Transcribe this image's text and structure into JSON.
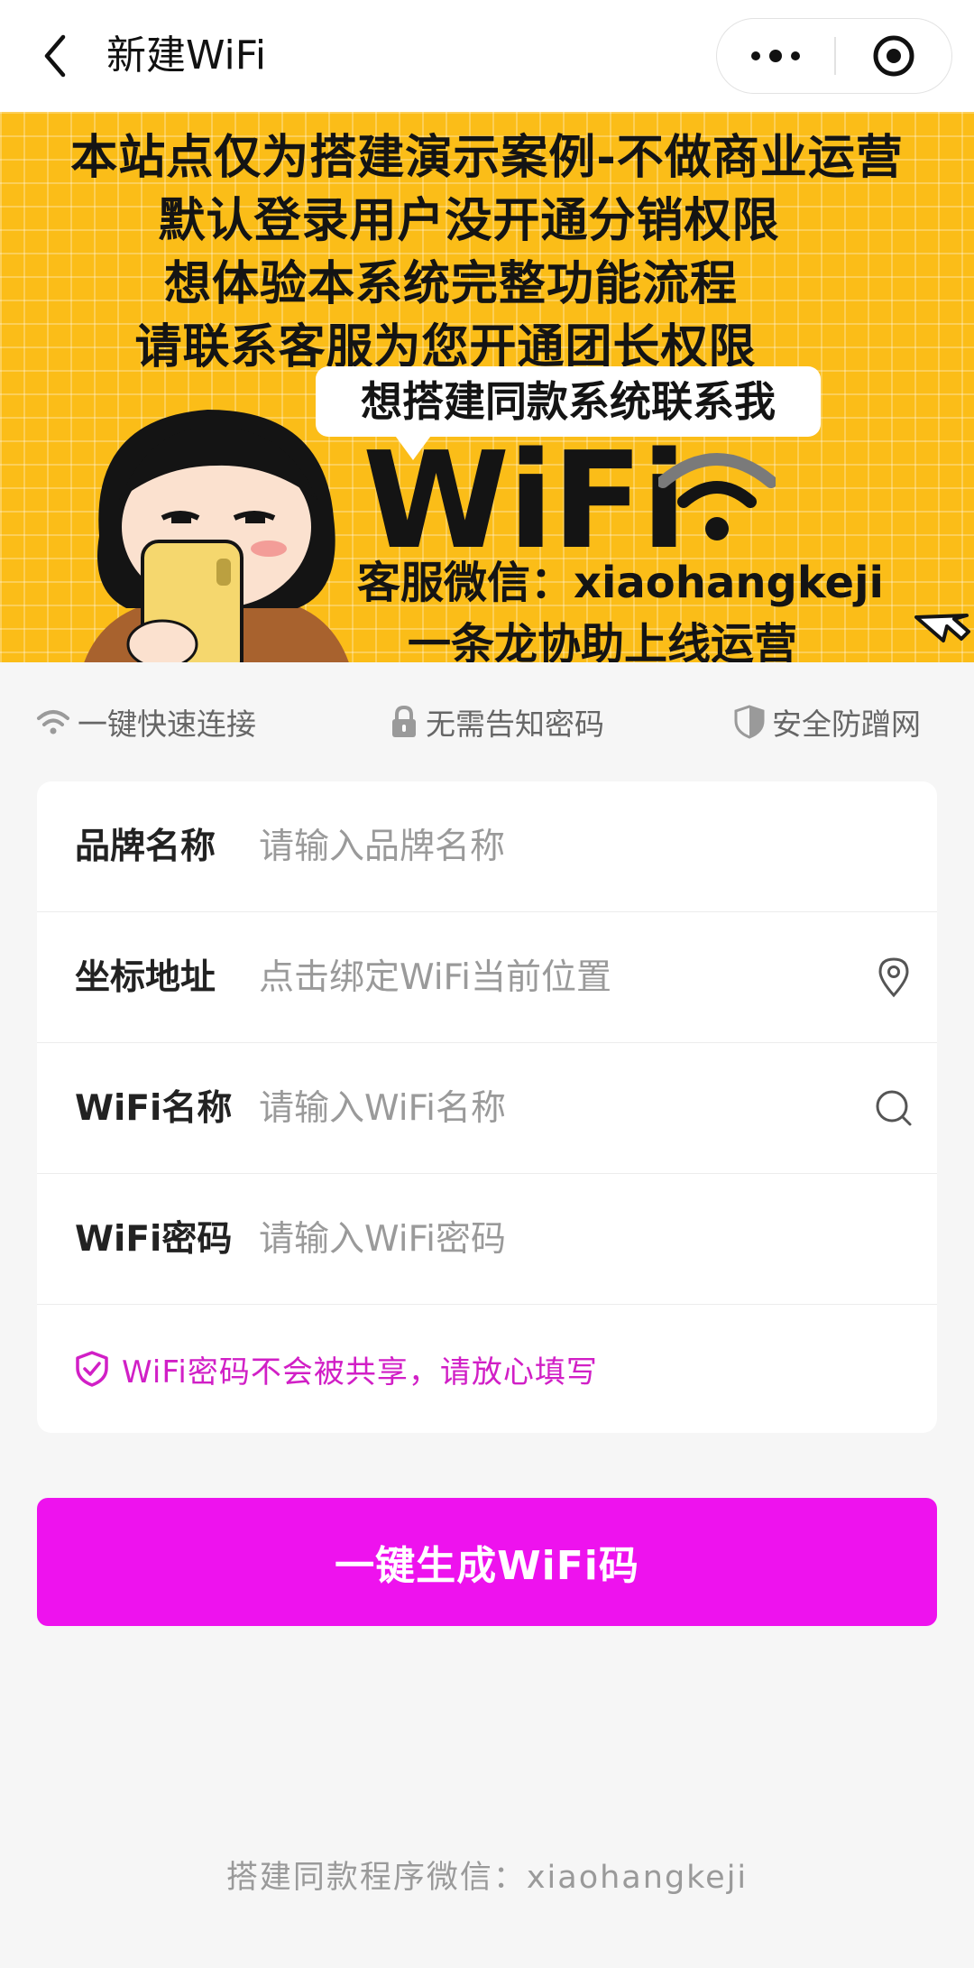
{
  "nav": {
    "title": "新建WiFi",
    "back_icon": "chevron-left-icon",
    "more_icon": "more-dots-icon",
    "close_icon": "target-icon"
  },
  "banner": {
    "lines": [
      "本站点仅为搭建演示案例-不做商业运营",
      "默认登录用户没开通分销权限",
      "想体验本系统完整功能流程",
      "请联系客服为您开通团长权限"
    ],
    "bubble": "想搭建同款系统联系我",
    "big_text": "WiFi",
    "contact": "客服微信：xiaohangkeji",
    "slogan": "一条龙协助上线运营",
    "background": "#fbbd18"
  },
  "features": [
    {
      "icon": "wifi-icon",
      "label": "一键快速连接"
    },
    {
      "icon": "lock-icon",
      "label": "无需告知密码"
    },
    {
      "icon": "shield-icon",
      "label": "安全防蹭网"
    }
  ],
  "form": {
    "brand": {
      "label": "品牌名称",
      "placeholder": "请输入品牌名称",
      "value": ""
    },
    "location": {
      "label": "坐标地址",
      "placeholder": "点击绑定WiFi当前位置",
      "value": "",
      "icon": "location-pin-icon"
    },
    "ssid": {
      "label": "WiFi名称",
      "placeholder": "请输入WiFi名称",
      "value": "",
      "icon": "search-icon"
    },
    "password": {
      "label": "WiFi密码",
      "placeholder": "请输入WiFi密码",
      "value": ""
    },
    "notice": "WiFi密码不会被共享，请放心填写",
    "notice_color": "#d11fc6"
  },
  "submit": {
    "label": "一键生成WiFi码",
    "color": "#ee12ee"
  },
  "footer": {
    "text": "搭建同款程序微信：xiaohangkeji"
  }
}
